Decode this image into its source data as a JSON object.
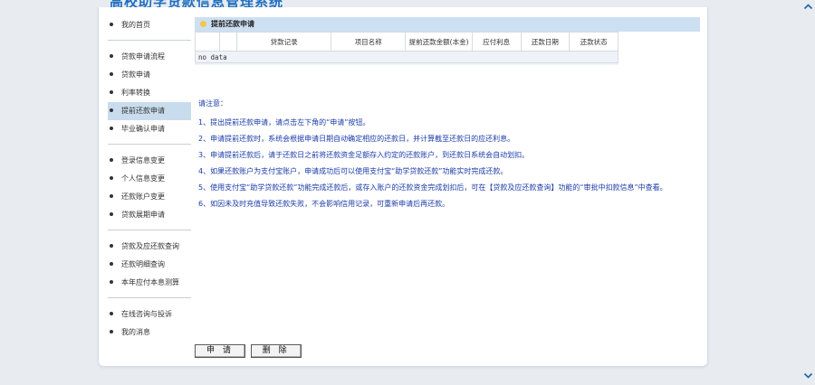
{
  "app": {
    "title": "高校助学贷款信息管理系统"
  },
  "sidebar": {
    "groups": [
      {
        "items": [
          {
            "label": "我的首页"
          }
        ]
      },
      {
        "items": [
          {
            "label": "贷款申请流程"
          },
          {
            "label": "贷款申请"
          },
          {
            "label": "利率转换"
          },
          {
            "label": "提前还款申请",
            "active": true
          },
          {
            "label": "毕业确认申请"
          }
        ]
      },
      {
        "items": [
          {
            "label": "登录信息变更"
          },
          {
            "label": "个人信息变更"
          },
          {
            "label": "还款账户变更"
          },
          {
            "label": "贷款展期申请"
          }
        ]
      },
      {
        "items": [
          {
            "label": "贷款及应还款查询"
          },
          {
            "label": "还款明细查询"
          },
          {
            "label": "本年应付本息测算"
          }
        ]
      },
      {
        "items": [
          {
            "label": "在线咨询与投诉"
          },
          {
            "label": "我的消息"
          }
        ]
      }
    ]
  },
  "panel": {
    "title": "提前还款申请",
    "table": {
      "columns": [
        "",
        "",
        "贷款记录",
        "项目名称",
        "提前还款金额(本金)",
        "应付利息",
        "还款日期",
        "还款状态"
      ],
      "empty_text": "no data"
    }
  },
  "notes": {
    "title": "请注意：",
    "items": [
      "1、提出提前还款申请，请点击左下角的“申请”按钮。",
      "2、申请提前还款时，系统会根据申请日期自动确定相应的还款日，并计算截至还款日的应还利息。",
      "3、申请提前还款后，请于还款日之前将还款资金足额存入约定的还款账户，到还款日系统会自动划扣。",
      "4、如果还款账户为支付宝账户，申请成功后可以使用支付宝“助学贷款还款”功能实时完成还款。",
      "5、使用支付宝“助学贷款还款”功能完成还款后，或存入账户的还款资金完成划扣后，可在【贷款及应还款查询】功能的“审批中扣款信息”中查看。",
      "6、如因未及时充值导致还款失败，不会影响信用记录，可重新申请后再还款。"
    ]
  },
  "buttons": {
    "apply": "申 请",
    "delete": "删 除"
  },
  "icons": {
    "scroll_up": "chevron-up-icon",
    "scroll_down": "chevron-down-icon"
  },
  "colors": {
    "accent": "#1f6fc0",
    "notes": "#1a3aa8",
    "header_bg": "#cddff2",
    "active_bg": "#c9dced"
  }
}
